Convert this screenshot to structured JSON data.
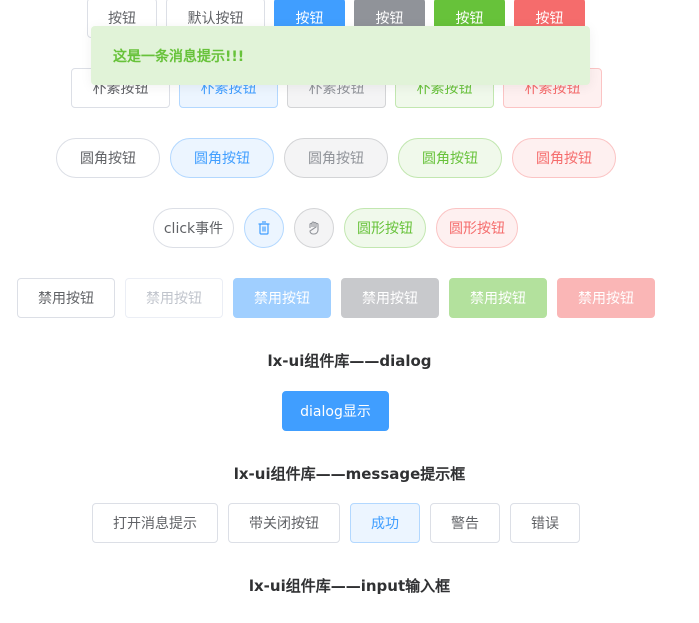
{
  "row1": {
    "buttons": [
      {
        "label": "按钮",
        "variant": "default"
      },
      {
        "label": "默认按钮",
        "variant": "default"
      },
      {
        "label": "按钮",
        "variant": "primary"
      },
      {
        "label": "按钮",
        "variant": "info"
      },
      {
        "label": "按钮",
        "variant": "success"
      },
      {
        "label": "按钮",
        "variant": "danger"
      }
    ]
  },
  "row_plain": {
    "label": "朴素按钮"
  },
  "row_round": {
    "label": "圆角按钮"
  },
  "row_circle": {
    "click_label": "click事件",
    "delete_icon": "trash-icon",
    "hand_icon": "hand-icon",
    "circle_label": "圆形按钮"
  },
  "row_disabled": {
    "label": "禁用按钮"
  },
  "dialog_section": {
    "heading": "lx-ui组件库——dialog",
    "button_label": "dialog显示"
  },
  "message_section": {
    "heading": "lx-ui组件库——message提示框",
    "buttons": [
      "打开消息提示",
      "带关闭按钮",
      "成功",
      "警告",
      "错误"
    ]
  },
  "input_section": {
    "heading": "lx-ui组件库——input输入框"
  },
  "toast": {
    "text": "这是一条消息提示!!!",
    "type": "success"
  },
  "colors": {
    "primary": "#409eff",
    "info": "#909399",
    "success": "#67c23a",
    "danger": "#f56c6c"
  }
}
